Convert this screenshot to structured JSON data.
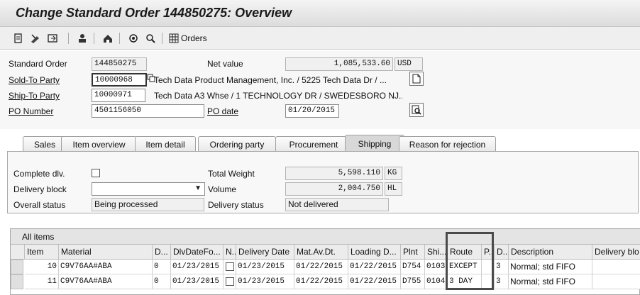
{
  "window": {
    "title": "Change Standard Order 144850275: Overview"
  },
  "toolbar": {
    "icons": [
      "display-document-icon",
      "change-icon",
      "header-icon",
      "customer-icon",
      "configure-icon",
      "status-icon",
      "grid-icon"
    ],
    "orders_label": "Orders"
  },
  "header": {
    "standard_order_label": "Standard Order",
    "standard_order_value": "144850275",
    "net_value_label": "Net value",
    "net_value_value": "1,085,533.60",
    "currency": "USD",
    "sold_to_label": "Sold-To Party",
    "sold_to_value": "10000968",
    "sold_to_text": "Tech Data Product Management, Inc. / 5225 Tech Data Dr / ...",
    "ship_to_label": "Ship-To Party",
    "ship_to_value": "10000971",
    "ship_to_text": "Tech Data A3 Whse / 1 TECHNOLOGY DR / SWEDESBORO NJ...",
    "po_number_label": "PO Number",
    "po_number_value": "4501156050",
    "po_date_label": "PO date",
    "po_date_value": "01/20/2015"
  },
  "tabs": [
    {
      "label": "Sales"
    },
    {
      "label": "Item overview"
    },
    {
      "label": "Item detail"
    },
    {
      "label": "Ordering party"
    },
    {
      "label": "Procurement"
    },
    {
      "label": "Shipping"
    },
    {
      "label": "Reason for rejection"
    }
  ],
  "shipping": {
    "complete_dlv_label": "Complete dlv.",
    "delivery_block_label": "Delivery block",
    "delivery_block_value": "",
    "overall_status_label": "Overall status",
    "overall_status_value": "Being processed",
    "total_weight_label": "Total Weight",
    "total_weight_value": "5,598.110",
    "weight_unit": "KG",
    "volume_label": "Volume",
    "volume_value": "2,004.750",
    "volume_unit": "HL",
    "delivery_status_label": "Delivery status",
    "delivery_status_value": "Not delivered"
  },
  "items_grid": {
    "caption": "All items",
    "columns": [
      "Item",
      "Material",
      "D...",
      "DlvDateFo...",
      "N...",
      "Delivery Date",
      "Mat.Av.Dt.",
      "Loading D...",
      "Plnt",
      "Shi...",
      "Route",
      "P...",
      "D...",
      "Description",
      "Delivery blo"
    ],
    "rows": [
      {
        "item": "10",
        "material": "C9V76AA#ABA",
        "d": "0",
        "dlvdate_fo": "01/23/2015",
        "delivery_date": "01/23/2015",
        "mat_av_dt": "01/22/2015",
        "loading_d": "01/22/2015",
        "plnt": "D754",
        "shi": "0103",
        "route": "EXCEPT",
        "p": "",
        "d2": "3",
        "description": "Normal; std FIFO",
        "delivery_block": ""
      },
      {
        "item": "11",
        "material": "C9V76AA#ABA",
        "d": "0",
        "dlvdate_fo": "01/23/2015",
        "delivery_date": "01/23/2015",
        "mat_av_dt": "01/22/2015",
        "loading_d": "01/22/2015",
        "plnt": "D755",
        "shi": "0104",
        "route": "3 DAY",
        "p": "",
        "d2": "3",
        "description": "Normal; std FIFO",
        "delivery_block": ""
      }
    ]
  }
}
